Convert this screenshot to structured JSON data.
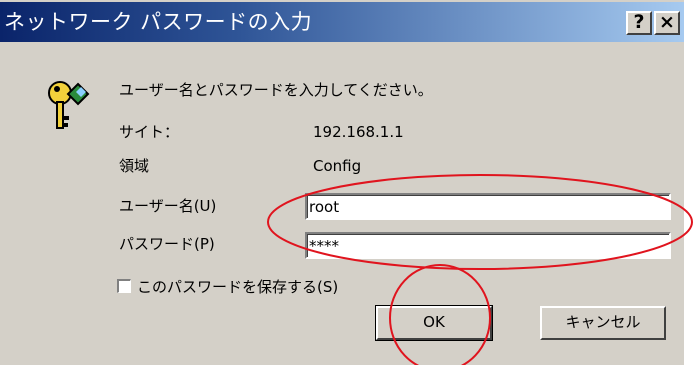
{
  "window": {
    "title": "ネットワーク パスワードの入力",
    "help_label": "?",
    "close_label": "×"
  },
  "prompt": "ユーザー名とパスワードを入力してください。",
  "site": {
    "label": "サイト：",
    "value": "192.168.1.1"
  },
  "realm": {
    "label": "領域",
    "value": "Config"
  },
  "username": {
    "label": "ユーザー名(U)",
    "value": "root"
  },
  "password": {
    "label": "パスワード(P)",
    "value": "****"
  },
  "save_password": {
    "label": "このパスワードを保存する(S)",
    "checked": false
  },
  "buttons": {
    "ok": "OK",
    "cancel": "キャンセル"
  },
  "annotations": {
    "color": "#e0141e"
  }
}
